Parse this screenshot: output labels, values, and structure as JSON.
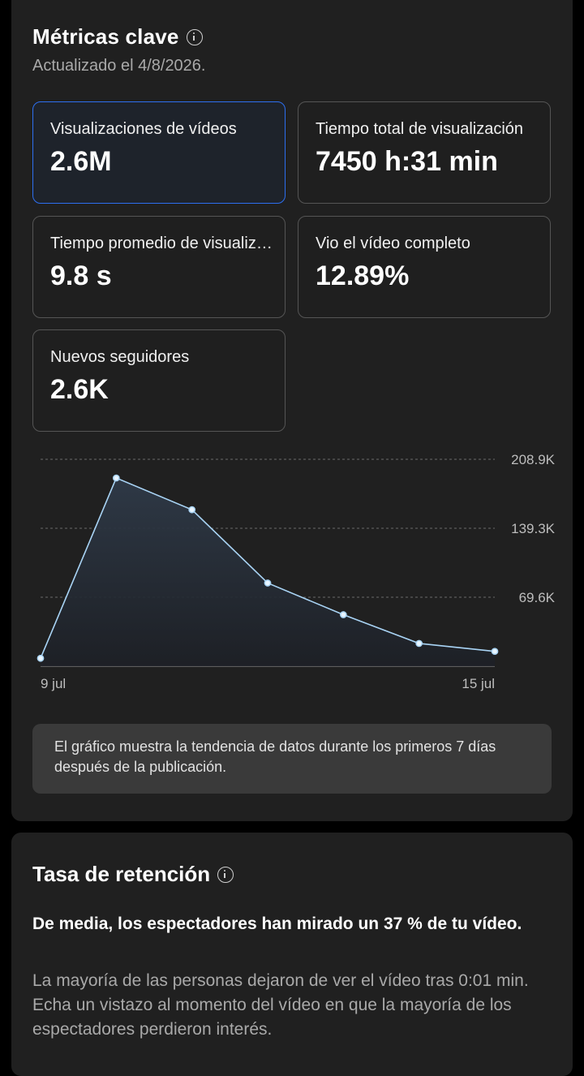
{
  "metrics": {
    "title": "Métricas clave",
    "updated": "Actualizado el 4/8/2026.",
    "tiles": [
      {
        "label": "Visualizaciones de vídeos",
        "value": "2.6M"
      },
      {
        "label": "Tiempo total de visualización",
        "value": "7450 h:31 min"
      },
      {
        "label": "Tiempo promedio de visualización",
        "value": "9.8 s"
      },
      {
        "label": "Vio el vídeo completo",
        "value": "12.89%"
      },
      {
        "label": "Nuevos seguidores",
        "value": "2.6K"
      }
    ],
    "note": "El gráfico muestra la tendencia de datos durante los primeros 7 días después de la publicación."
  },
  "chart_data": {
    "type": "area",
    "x": [
      "9 jul",
      "10 jul",
      "11 jul",
      "12 jul",
      "13 jul",
      "14 jul",
      "15 jul"
    ],
    "x_tick_labels": [
      "9 jul",
      "15 jul"
    ],
    "values": [
      8000,
      190000,
      158000,
      84000,
      52000,
      23000,
      15000
    ],
    "y_tick_labels": [
      "208.9K",
      "139.3K",
      "69.6K"
    ],
    "y_ticks": [
      208900,
      139300,
      69600
    ],
    "ylim": [
      0,
      208900
    ],
    "grid": "dashed horizontal",
    "line_color": "#a9d4f5",
    "fill_color": "#2c3440"
  },
  "retention": {
    "title": "Tasa de retención",
    "headline": "De media, los espectadores han mirado un 37 % de tu vídeo.",
    "body": "La mayoría de las personas dejaron de ver el vídeo tras 0:01 min. Echa un vistazo al momento del vídeo en que la mayoría de los espectadores perdieron interés."
  }
}
